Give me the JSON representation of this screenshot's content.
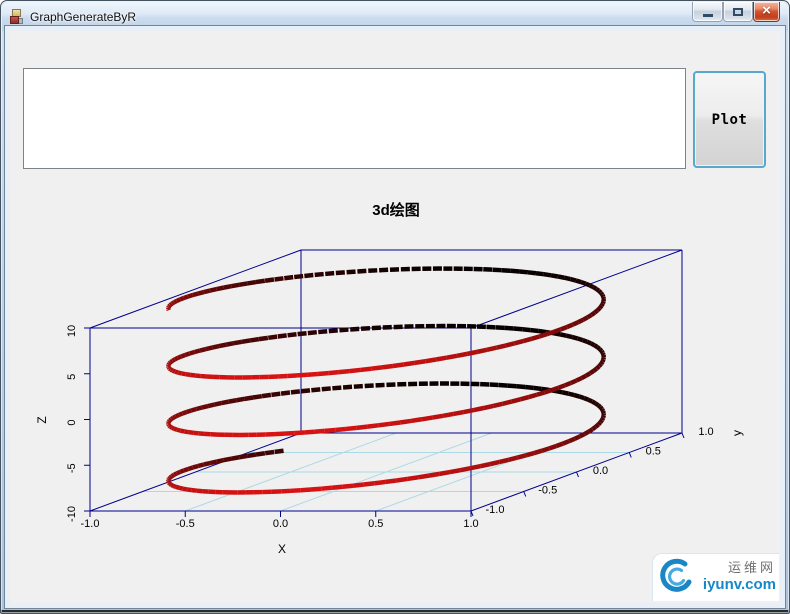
{
  "window": {
    "title": "GraphGenerateByR",
    "controls": {
      "minimize": "minimize",
      "maximize": "maximize",
      "close": "close"
    }
  },
  "toolbar": {
    "command_value": "",
    "plot_label": "Plot"
  },
  "chart_data": {
    "type": "line",
    "projection": "3d",
    "title": "3d绘图",
    "description": "3D helix x=cos(t), y=sin(t), z=t drawn in an R scatterplot3d-style box; curve colored bright red at front (y=-1) fading to black at back (y=+1); back portions appear dashed",
    "parametric": {
      "x": "cos(t)",
      "y": "sin(t)",
      "z": "t",
      "t_min": -10,
      "t_max": 10,
      "t_step": 0.05
    },
    "axes": {
      "x": {
        "label": "X",
        "range": [
          -1,
          1
        ],
        "ticks": [
          -1,
          -0.5,
          0,
          0.5,
          1
        ],
        "tick_labels": [
          "-1.0",
          "-0.5",
          "0.0",
          "0.5",
          "1.0"
        ]
      },
      "y": {
        "label": "y",
        "range": [
          -1,
          1
        ],
        "ticks": [
          -1,
          -0.5,
          0,
          0.5,
          1
        ],
        "tick_labels": [
          "-1.0",
          "-0.5",
          "0.0",
          "0.5",
          "1.0"
        ]
      },
      "z": {
        "label": "Z",
        "range": [
          -10,
          10
        ],
        "ticks": [
          -10,
          -5,
          0,
          5,
          10
        ],
        "tick_labels": [
          "-10",
          "-5",
          "0",
          "5",
          "10"
        ]
      }
    },
    "grid": true,
    "legend": false,
    "style": {
      "axis_color": "#00008b",
      "grid_color": "#add8e6",
      "color_near": "#d81212",
      "color_far": "#060000",
      "line_width": 4.5,
      "tick_font_size": 11,
      "label_font_size": 12
    }
  },
  "watermark": {
    "site_name": "运维网",
    "site_url": "iyunv.com",
    "accent_color": "#1588cc"
  }
}
